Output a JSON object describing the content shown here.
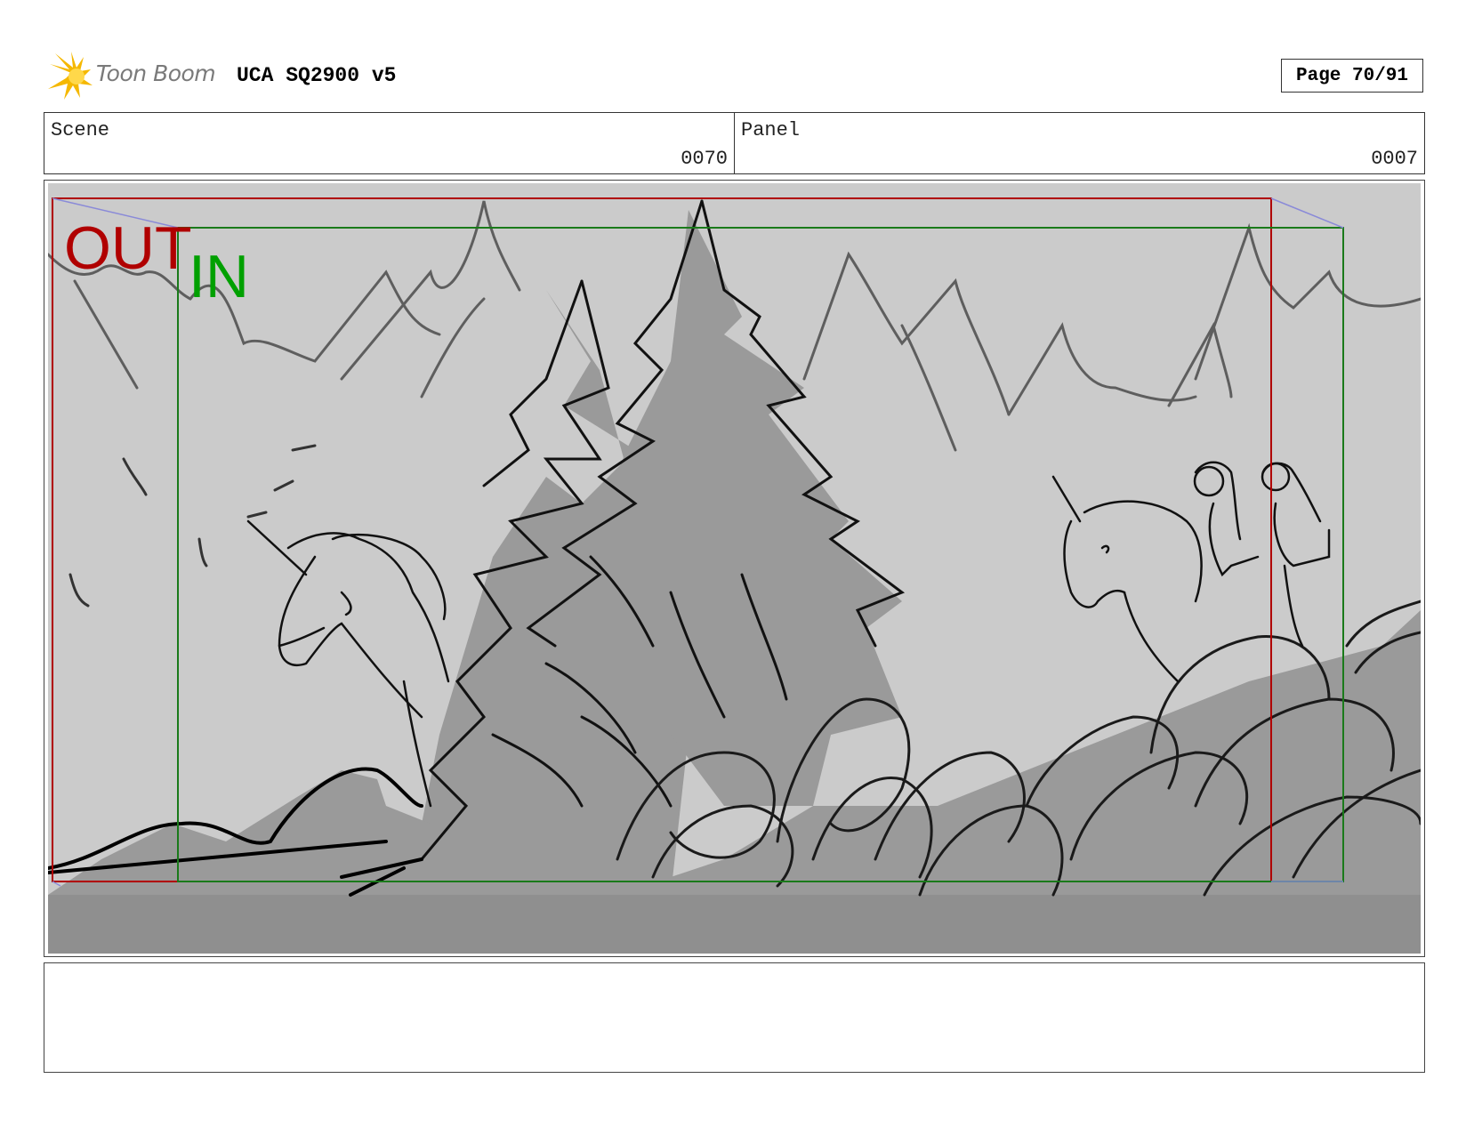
{
  "header": {
    "logo_text": "Toon Boom",
    "title": "UCA SQ2900 v5",
    "page_label": "Page 70/91"
  },
  "info": {
    "scene_label": "Scene",
    "scene_value": "0070",
    "panel_label": "Panel",
    "panel_value": "0007"
  },
  "frame": {
    "out_label": "OUT",
    "in_label": "IN",
    "out_color": "#b00000",
    "in_color": "#00a000"
  },
  "notes": {
    "text": ""
  }
}
